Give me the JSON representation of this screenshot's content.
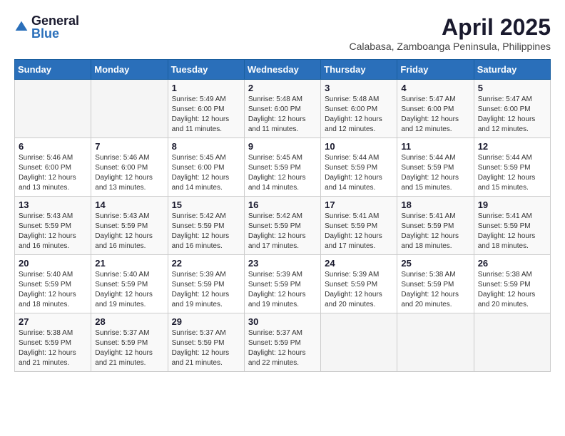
{
  "logo": {
    "general": "General",
    "blue": "Blue"
  },
  "title": {
    "month": "April 2025",
    "location": "Calabasa, Zamboanga Peninsula, Philippines"
  },
  "headers": [
    "Sunday",
    "Monday",
    "Tuesday",
    "Wednesday",
    "Thursday",
    "Friday",
    "Saturday"
  ],
  "weeks": [
    [
      {
        "day": "",
        "info": ""
      },
      {
        "day": "",
        "info": ""
      },
      {
        "day": "1",
        "info": "Sunrise: 5:49 AM\nSunset: 6:00 PM\nDaylight: 12 hours and 11 minutes."
      },
      {
        "day": "2",
        "info": "Sunrise: 5:48 AM\nSunset: 6:00 PM\nDaylight: 12 hours and 11 minutes."
      },
      {
        "day": "3",
        "info": "Sunrise: 5:48 AM\nSunset: 6:00 PM\nDaylight: 12 hours and 12 minutes."
      },
      {
        "day": "4",
        "info": "Sunrise: 5:47 AM\nSunset: 6:00 PM\nDaylight: 12 hours and 12 minutes."
      },
      {
        "day": "5",
        "info": "Sunrise: 5:47 AM\nSunset: 6:00 PM\nDaylight: 12 hours and 12 minutes."
      }
    ],
    [
      {
        "day": "6",
        "info": "Sunrise: 5:46 AM\nSunset: 6:00 PM\nDaylight: 12 hours and 13 minutes."
      },
      {
        "day": "7",
        "info": "Sunrise: 5:46 AM\nSunset: 6:00 PM\nDaylight: 12 hours and 13 minutes."
      },
      {
        "day": "8",
        "info": "Sunrise: 5:45 AM\nSunset: 6:00 PM\nDaylight: 12 hours and 14 minutes."
      },
      {
        "day": "9",
        "info": "Sunrise: 5:45 AM\nSunset: 5:59 PM\nDaylight: 12 hours and 14 minutes."
      },
      {
        "day": "10",
        "info": "Sunrise: 5:44 AM\nSunset: 5:59 PM\nDaylight: 12 hours and 14 minutes."
      },
      {
        "day": "11",
        "info": "Sunrise: 5:44 AM\nSunset: 5:59 PM\nDaylight: 12 hours and 15 minutes."
      },
      {
        "day": "12",
        "info": "Sunrise: 5:44 AM\nSunset: 5:59 PM\nDaylight: 12 hours and 15 minutes."
      }
    ],
    [
      {
        "day": "13",
        "info": "Sunrise: 5:43 AM\nSunset: 5:59 PM\nDaylight: 12 hours and 16 minutes."
      },
      {
        "day": "14",
        "info": "Sunrise: 5:43 AM\nSunset: 5:59 PM\nDaylight: 12 hours and 16 minutes."
      },
      {
        "day": "15",
        "info": "Sunrise: 5:42 AM\nSunset: 5:59 PM\nDaylight: 12 hours and 16 minutes."
      },
      {
        "day": "16",
        "info": "Sunrise: 5:42 AM\nSunset: 5:59 PM\nDaylight: 12 hours and 17 minutes."
      },
      {
        "day": "17",
        "info": "Sunrise: 5:41 AM\nSunset: 5:59 PM\nDaylight: 12 hours and 17 minutes."
      },
      {
        "day": "18",
        "info": "Sunrise: 5:41 AM\nSunset: 5:59 PM\nDaylight: 12 hours and 18 minutes."
      },
      {
        "day": "19",
        "info": "Sunrise: 5:41 AM\nSunset: 5:59 PM\nDaylight: 12 hours and 18 minutes."
      }
    ],
    [
      {
        "day": "20",
        "info": "Sunrise: 5:40 AM\nSunset: 5:59 PM\nDaylight: 12 hours and 18 minutes."
      },
      {
        "day": "21",
        "info": "Sunrise: 5:40 AM\nSunset: 5:59 PM\nDaylight: 12 hours and 19 minutes."
      },
      {
        "day": "22",
        "info": "Sunrise: 5:39 AM\nSunset: 5:59 PM\nDaylight: 12 hours and 19 minutes."
      },
      {
        "day": "23",
        "info": "Sunrise: 5:39 AM\nSunset: 5:59 PM\nDaylight: 12 hours and 19 minutes."
      },
      {
        "day": "24",
        "info": "Sunrise: 5:39 AM\nSunset: 5:59 PM\nDaylight: 12 hours and 20 minutes."
      },
      {
        "day": "25",
        "info": "Sunrise: 5:38 AM\nSunset: 5:59 PM\nDaylight: 12 hours and 20 minutes."
      },
      {
        "day": "26",
        "info": "Sunrise: 5:38 AM\nSunset: 5:59 PM\nDaylight: 12 hours and 20 minutes."
      }
    ],
    [
      {
        "day": "27",
        "info": "Sunrise: 5:38 AM\nSunset: 5:59 PM\nDaylight: 12 hours and 21 minutes."
      },
      {
        "day": "28",
        "info": "Sunrise: 5:37 AM\nSunset: 5:59 PM\nDaylight: 12 hours and 21 minutes."
      },
      {
        "day": "29",
        "info": "Sunrise: 5:37 AM\nSunset: 5:59 PM\nDaylight: 12 hours and 21 minutes."
      },
      {
        "day": "30",
        "info": "Sunrise: 5:37 AM\nSunset: 5:59 PM\nDaylight: 12 hours and 22 minutes."
      },
      {
        "day": "",
        "info": ""
      },
      {
        "day": "",
        "info": ""
      },
      {
        "day": "",
        "info": ""
      }
    ]
  ]
}
